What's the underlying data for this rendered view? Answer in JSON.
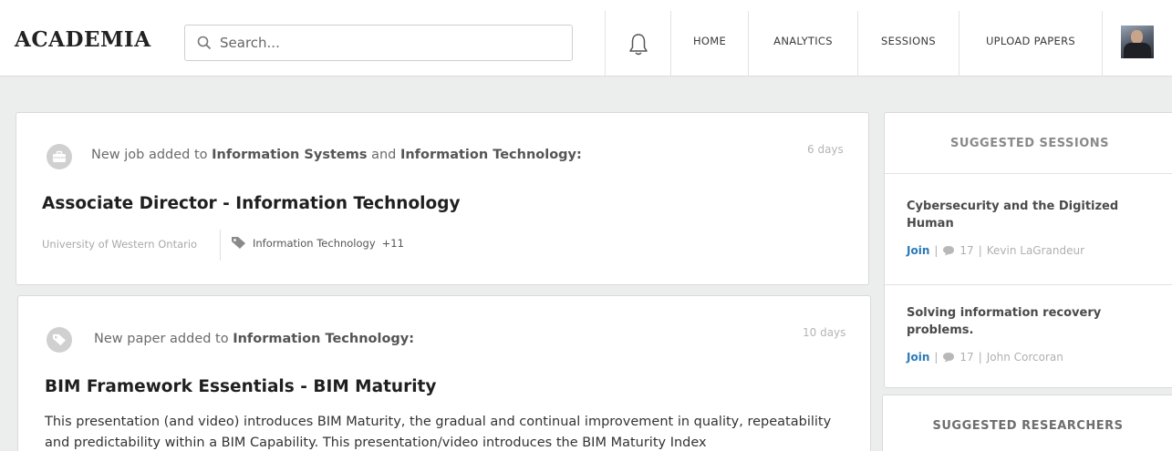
{
  "app": {
    "logo": "ACADEMIA"
  },
  "search": {
    "placeholder": "Search..."
  },
  "nav": {
    "items": [
      {
        "label": "HOME"
      },
      {
        "label": "ANALYTICS"
      },
      {
        "label": "SESSIONS"
      },
      {
        "label": "UPLOAD PAPERS"
      }
    ]
  },
  "feed": [
    {
      "icon": "briefcase-icon",
      "prefix": "New job added to ",
      "topic1": "Information Systems",
      "joiner": " and ",
      "topic2": "Information Technology:",
      "time": "6 days",
      "title": "Associate Director - Information Technology",
      "org": "University of Western Ontario",
      "tag": "Information Technology",
      "tag_more": "+11"
    },
    {
      "icon": "tag-icon",
      "prefix": "New paper added to ",
      "topic1": "Information Technology:",
      "time": "10 days",
      "title": "BIM Framework Essentials - BIM Maturity",
      "body": "This presentation (and video) introduces BIM Maturity, the gradual and continual improvement in quality, repeatability and predictability within a BIM Capability. This presentation/video introduces the BIM Maturity Index"
    }
  ],
  "sidebar": {
    "sessions_heading": "SUGGESTED SESSIONS",
    "sessions": [
      {
        "title": "Cybersecurity and the Digitized Human",
        "join": "Join",
        "sep1": "|",
        "comments": "17",
        "sep2": "|",
        "author": "Kevin LaGrandeur"
      },
      {
        "title": "Solving information recovery problems.",
        "join": "Join",
        "sep1": "|",
        "comments": "17",
        "sep2": "|",
        "author": "John Corcoran"
      }
    ],
    "researchers_heading": "SUGGESTED RESEARCHERS"
  },
  "colors": {
    "link": "#2a7ab8",
    "background": "#eceeee",
    "muted": "#b0b0b0"
  }
}
